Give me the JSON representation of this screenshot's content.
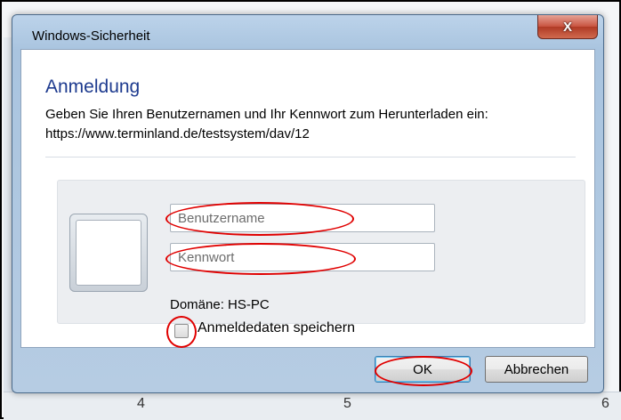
{
  "window": {
    "title": "Windows-Sicherheit",
    "close_glyph": "X"
  },
  "dialog": {
    "heading": "Anmeldung",
    "description": "Geben Sie Ihren Benutzernamen und Ihr Kennwort zum Herunterladen ein: https://www.terminland.de/testsystem/dav/12"
  },
  "credentials": {
    "username_placeholder": "Benutzername",
    "username_value": "",
    "password_placeholder": "Kennwort",
    "password_value": "",
    "domain_label": "Domäne: HS-PC",
    "remember_label": "Anmeldedaten speichern",
    "remember_checked": false
  },
  "buttons": {
    "ok_label": "OK",
    "cancel_label": "Abbrechen"
  },
  "background": {
    "bottom_numbers": [
      "4",
      "5",
      "6"
    ]
  },
  "colors": {
    "heading": "#1e3b8f",
    "annotation": "#e00000",
    "close_button": "#c8523e"
  }
}
